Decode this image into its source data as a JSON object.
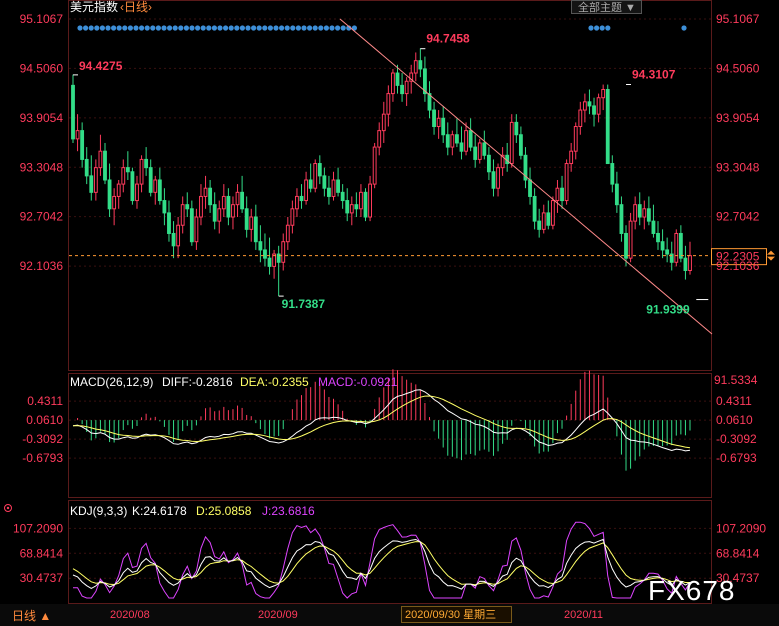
{
  "header": {
    "title": "美元指数",
    "period": "‹日线›",
    "theme_selector": "全部主题 ▼"
  },
  "footer": {
    "period_button": "日线 ▲",
    "x_ticks": [
      "2020/08",
      "2020/09",
      "2020/11"
    ],
    "cursor_date": "2020/09/30 星期三",
    "watermark": "FX678"
  },
  "colors": {
    "up": "#ff3b5c",
    "down": "#33dd88",
    "bg": "#000000",
    "grid": "#3a1010",
    "axis_label": "#ff3b5c",
    "dif_line": "#ffffff",
    "dea_line": "#ffff66",
    "macd_text": "#dd44ff",
    "k_line": "#ffffff",
    "d_line": "#ffff66",
    "j_line": "#dd44ff",
    "marker_dots": "#3d8fd8"
  },
  "chart_data": [
    {
      "type": "candlestick",
      "title": "美元指数",
      "y_ticks": [
        "95.1067",
        "94.5060",
        "93.9054",
        "93.3048",
        "92.7042",
        "92.1036"
      ],
      "right_extra_tick": "91.5334",
      "ylim": [
        91.5334,
        95.1067
      ],
      "last_price": "92.2305",
      "annotations": [
        {
          "label": "94.4275",
          "value": 94.4275,
          "index": 0
        },
        {
          "label": "91.7387",
          "value": 91.7387,
          "index": 45
        },
        {
          "label": "94.7458",
          "value": 94.7458,
          "index": 76
        },
        {
          "label": "94.3107",
          "value": 94.3107,
          "index": 121
        },
        {
          "label": "91.9399",
          "value": 91.9399,
          "index": 139
        }
      ],
      "candles": [
        [
          94.3,
          94.43,
          93.6,
          93.65
        ],
        [
          93.65,
          93.95,
          93.5,
          93.75
        ],
        [
          93.75,
          93.85,
          93.3,
          93.4
        ],
        [
          93.4,
          93.55,
          93.1,
          93.2
        ],
        [
          93.2,
          93.45,
          92.9,
          93.0
        ],
        [
          93.0,
          93.4,
          92.9,
          93.3
        ],
        [
          93.3,
          93.7,
          93.2,
          93.5
        ],
        [
          93.5,
          93.6,
          93.1,
          93.15
        ],
        [
          93.15,
          93.35,
          92.7,
          92.8
        ],
        [
          92.8,
          93.05,
          92.6,
          92.95
        ],
        [
          92.95,
          93.15,
          92.8,
          93.1
        ],
        [
          93.1,
          93.4,
          93.0,
          93.3
        ],
        [
          93.3,
          93.5,
          93.15,
          93.25
        ],
        [
          93.25,
          93.3,
          92.85,
          92.9
        ],
        [
          92.9,
          93.2,
          92.8,
          93.1
        ],
        [
          93.1,
          93.45,
          93.0,
          93.4
        ],
        [
          93.4,
          93.55,
          93.2,
          93.3
        ],
        [
          93.3,
          93.4,
          92.95,
          93.0
        ],
        [
          93.0,
          93.2,
          92.85,
          93.15
        ],
        [
          93.15,
          93.3,
          92.85,
          92.9
        ],
        [
          92.9,
          93.05,
          92.6,
          92.75
        ],
        [
          92.75,
          92.9,
          92.4,
          92.5
        ],
        [
          92.5,
          92.65,
          92.2,
          92.35
        ],
        [
          92.35,
          92.7,
          92.2,
          92.6
        ],
        [
          92.6,
          92.95,
          92.5,
          92.85
        ],
        [
          92.85,
          93.0,
          92.7,
          92.8
        ],
        [
          92.8,
          92.9,
          92.35,
          92.4
        ],
        [
          92.4,
          92.8,
          92.3,
          92.7
        ],
        [
          92.7,
          93.1,
          92.6,
          92.95
        ],
        [
          92.95,
          93.2,
          92.8,
          93.05
        ],
        [
          93.05,
          93.15,
          92.75,
          92.85
        ],
        [
          92.85,
          93.0,
          92.55,
          92.65
        ],
        [
          92.65,
          92.9,
          92.5,
          92.8
        ],
        [
          92.8,
          93.1,
          92.7,
          92.95
        ],
        [
          92.95,
          93.05,
          92.6,
          92.7
        ],
        [
          92.7,
          92.95,
          92.55,
          92.85
        ],
        [
          92.85,
          93.1,
          92.7,
          93.0
        ],
        [
          93.0,
          93.2,
          92.75,
          92.8
        ],
        [
          92.8,
          92.95,
          92.45,
          92.55
        ],
        [
          92.55,
          92.8,
          92.4,
          92.7
        ],
        [
          92.7,
          92.85,
          92.3,
          92.4
        ],
        [
          92.4,
          92.6,
          92.15,
          92.3
        ],
        [
          92.3,
          92.5,
          92.1,
          92.2
        ],
        [
          92.2,
          92.45,
          92.0,
          92.1
        ],
        [
          92.1,
          92.3,
          91.95,
          92.25
        ],
        [
          92.25,
          92.35,
          91.74,
          92.15
        ],
        [
          92.15,
          92.5,
          92.05,
          92.4
        ],
        [
          92.4,
          92.7,
          92.3,
          92.6
        ],
        [
          92.6,
          92.9,
          92.5,
          92.8
        ],
        [
          92.8,
          93.05,
          92.7,
          92.95
        ],
        [
          92.95,
          93.1,
          92.8,
          92.9
        ],
        [
          92.9,
          93.25,
          92.85,
          93.15
        ],
        [
          93.15,
          93.35,
          93.0,
          93.05
        ],
        [
          93.05,
          93.4,
          93.0,
          93.35
        ],
        [
          93.35,
          93.45,
          93.1,
          93.2
        ],
        [
          93.2,
          93.3,
          92.95,
          93.05
        ],
        [
          93.05,
          93.2,
          92.85,
          92.95
        ],
        [
          92.95,
          93.25,
          92.9,
          93.15
        ],
        [
          93.15,
          93.3,
          92.95,
          93.0
        ],
        [
          93.0,
          93.1,
          92.8,
          92.9
        ],
        [
          92.9,
          93.05,
          92.65,
          92.75
        ],
        [
          92.75,
          92.95,
          92.6,
          92.85
        ],
        [
          92.85,
          93.0,
          92.7,
          92.8
        ],
        [
          92.8,
          93.1,
          92.7,
          93.0
        ],
        [
          93.0,
          93.05,
          92.65,
          92.7
        ],
        [
          92.7,
          93.2,
          92.65,
          93.1
        ],
        [
          93.1,
          93.6,
          93.05,
          93.55
        ],
        [
          93.55,
          93.85,
          93.45,
          93.75
        ],
        [
          93.75,
          94.1,
          93.6,
          93.95
        ],
        [
          93.95,
          94.3,
          93.8,
          94.2
        ],
        [
          94.2,
          94.5,
          94.1,
          94.45
        ],
        [
          94.45,
          94.55,
          94.2,
          94.3
        ],
        [
          94.3,
          94.45,
          94.1,
          94.2
        ],
        [
          94.2,
          94.4,
          94.05,
          94.35
        ],
        [
          94.35,
          94.55,
          94.2,
          94.45
        ],
        [
          94.45,
          94.7,
          94.35,
          94.6
        ],
        [
          94.6,
          94.75,
          94.4,
          94.5
        ],
        [
          94.5,
          94.65,
          94.1,
          94.2
        ],
        [
          94.2,
          94.35,
          93.9,
          94.0
        ],
        [
          94.0,
          94.1,
          93.7,
          93.8
        ],
        [
          93.8,
          94.0,
          93.65,
          93.9
        ],
        [
          93.9,
          94.05,
          93.6,
          93.7
        ],
        [
          93.7,
          93.85,
          93.45,
          93.55
        ],
        [
          93.55,
          93.75,
          93.45,
          93.7
        ],
        [
          93.7,
          93.9,
          93.55,
          93.6
        ],
        [
          93.6,
          93.8,
          93.4,
          93.5
        ],
        [
          93.5,
          93.85,
          93.45,
          93.75
        ],
        [
          93.75,
          93.9,
          93.5,
          93.55
        ],
        [
          93.55,
          93.7,
          93.3,
          93.4
        ],
        [
          93.4,
          93.65,
          93.35,
          93.6
        ],
        [
          93.6,
          93.75,
          93.4,
          93.45
        ],
        [
          93.45,
          93.55,
          93.15,
          93.25
        ],
        [
          93.25,
          93.4,
          92.95,
          93.05
        ],
        [
          93.05,
          93.35,
          92.95,
          93.3
        ],
        [
          93.3,
          93.55,
          93.2,
          93.45
        ],
        [
          93.45,
          93.6,
          93.25,
          93.35
        ],
        [
          93.35,
          93.95,
          93.3,
          93.85
        ],
        [
          93.85,
          93.95,
          93.6,
          93.7
        ],
        [
          93.7,
          93.8,
          93.4,
          93.45
        ],
        [
          93.45,
          93.55,
          93.05,
          93.15
        ],
        [
          93.15,
          93.3,
          92.85,
          92.95
        ],
        [
          92.95,
          93.05,
          92.55,
          92.65
        ],
        [
          92.65,
          92.8,
          92.45,
          92.55
        ],
        [
          92.55,
          92.85,
          92.5,
          92.75
        ],
        [
          92.75,
          92.9,
          92.55,
          92.6
        ],
        [
          92.6,
          92.95,
          92.55,
          92.9
        ],
        [
          92.9,
          93.15,
          92.75,
          93.05
        ],
        [
          93.05,
          93.2,
          92.8,
          92.9
        ],
        [
          92.9,
          93.4,
          92.85,
          93.35
        ],
        [
          93.35,
          93.6,
          93.25,
          93.5
        ],
        [
          93.5,
          93.85,
          93.4,
          93.8
        ],
        [
          93.8,
          94.1,
          93.7,
          94.0
        ],
        [
          94.0,
          94.2,
          93.85,
          94.1
        ],
        [
          94.1,
          94.25,
          93.95,
          94.05
        ],
        [
          94.05,
          94.15,
          93.8,
          93.95
        ],
        [
          93.95,
          94.2,
          93.85,
          94.15
        ],
        [
          94.15,
          94.31,
          94.0,
          94.25
        ],
        [
          94.25,
          94.31,
          93.8,
          93.35
        ],
        [
          93.35,
          93.45,
          93.0,
          93.1
        ],
        [
          93.1,
          93.25,
          92.75,
          92.85
        ],
        [
          92.85,
          92.95,
          92.4,
          92.5
        ],
        [
          92.5,
          92.6,
          92.1,
          92.2
        ],
        [
          92.2,
          92.75,
          92.15,
          92.65
        ],
        [
          92.65,
          92.95,
          92.55,
          92.85
        ],
        [
          92.85,
          93.0,
          92.6,
          92.7
        ],
        [
          92.7,
          92.9,
          92.55,
          92.8
        ],
        [
          92.8,
          92.95,
          92.6,
          92.65
        ],
        [
          92.65,
          92.85,
          92.45,
          92.5
        ],
        [
          92.5,
          92.65,
          92.3,
          92.4
        ],
        [
          92.4,
          92.55,
          92.2,
          92.3
        ],
        [
          92.3,
          92.45,
          92.15,
          92.25
        ],
        [
          92.25,
          92.4,
          92.05,
          92.15
        ],
        [
          92.15,
          92.55,
          92.1,
          92.5
        ],
        [
          92.5,
          92.6,
          92.15,
          92.2
        ],
        [
          92.2,
          92.35,
          91.94,
          92.05
        ],
        [
          92.05,
          92.4,
          92.0,
          92.23
        ]
      ],
      "trendline": {
        "from_value": 95.1067,
        "to_value": 91.95
      }
    },
    {
      "type": "macd",
      "label": "MACD(26,12,9)",
      "dif_text": "DIFF:-0.2816",
      "dea_text": "DEA:-0.2355",
      "macd_text": "MACD:-0.0921",
      "y_ticks": [
        "0.4311",
        "0.0610",
        "-0.3092",
        "-0.6793"
      ],
      "ylim": [
        -0.95,
        0.55
      ]
    },
    {
      "type": "kdj",
      "label": "KDJ(9,3,3)",
      "k_text": "K:24.6178",
      "d_text": "D:25.0858",
      "j_text": "J:23.6816",
      "y_ticks": [
        "107.2090",
        "68.8414",
        "30.4737"
      ],
      "ylim": [
        0,
        120
      ]
    }
  ]
}
